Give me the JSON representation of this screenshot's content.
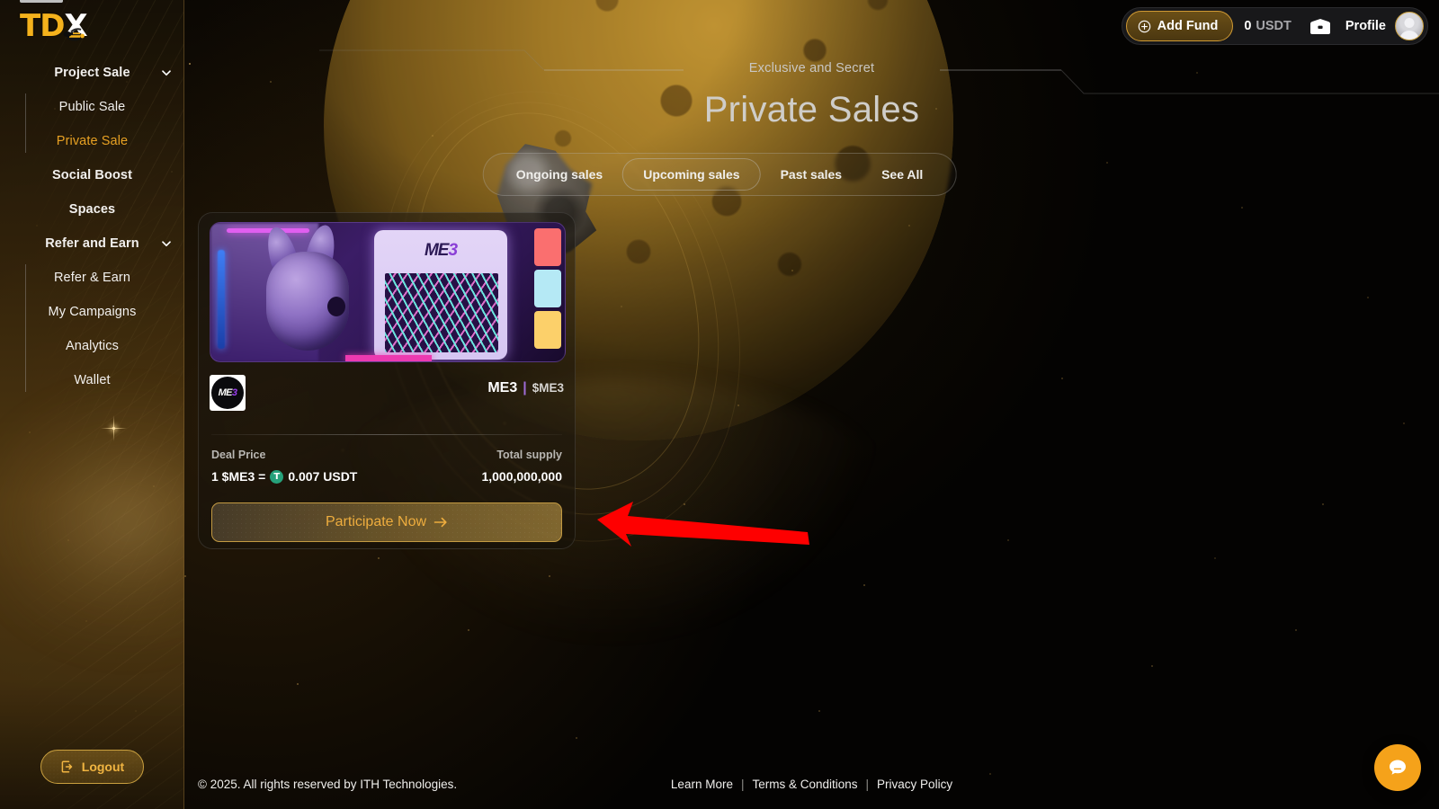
{
  "brand": {
    "name_gold": "TD",
    "name_white": "X",
    "icon": "bee-icon"
  },
  "sidebar": {
    "items": [
      {
        "label": "Project Sale",
        "type": "group",
        "expanded": true,
        "icon": "chevron-down-icon",
        "name": "project-sale"
      },
      {
        "label": "Public Sale",
        "type": "sub",
        "name": "public-sale"
      },
      {
        "label": "Private Sale",
        "type": "sub",
        "active": true,
        "name": "private-sale"
      },
      {
        "label": "Social Boost",
        "type": "item",
        "name": "social-boost"
      },
      {
        "label": "Spaces",
        "type": "item",
        "name": "spaces"
      },
      {
        "label": "Refer and Earn",
        "type": "group",
        "expanded": true,
        "icon": "chevron-down-icon",
        "name": "refer-and-earn"
      },
      {
        "label": "Refer & Earn",
        "type": "sub",
        "name": "refer-earn"
      },
      {
        "label": "My Campaigns",
        "type": "sub",
        "name": "my-campaigns"
      },
      {
        "label": "Analytics",
        "type": "sub",
        "name": "analytics"
      },
      {
        "label": "Wallet",
        "type": "sub",
        "name": "wallet"
      }
    ],
    "logout": {
      "label": "Logout",
      "icon": "logout-icon"
    }
  },
  "header": {
    "add_fund_label": "Add Fund",
    "add_fund_icon": "plus-circle-icon",
    "balance_amount": "0",
    "balance_currency": "USDT",
    "wallet_icon": "wallet-icon",
    "profile_label": "Profile",
    "avatar_icon": "user-avatar"
  },
  "hero": {
    "eyebrow": "Exclusive and Secret",
    "title": "Private Sales"
  },
  "tabs": {
    "items": [
      {
        "label": "Ongoing sales",
        "active": false,
        "name": "tab-ongoing-sales"
      },
      {
        "label": "Upcoming sales",
        "active": true,
        "name": "tab-upcoming-sales"
      },
      {
        "label": "Past sales",
        "active": false,
        "name": "tab-past-sales"
      },
      {
        "label": "See All",
        "active": false,
        "name": "tab-see-all"
      }
    ]
  },
  "sale_card": {
    "banner_logo_me": "ME",
    "banner_logo_3": "3",
    "coin_logo_me": "ME",
    "coin_logo_3": "3",
    "project_name": "ME3",
    "separator": "|",
    "symbol": "$ME3",
    "deal_price_label": "Deal Price",
    "deal_price_prefix": "1 $ME3 =",
    "deal_price_token_badge": "T",
    "deal_price_value": "0.007 USDT",
    "total_supply_label": "Total supply",
    "total_supply_value": "1,000,000,000",
    "cta_label": "Participate Now",
    "cta_icon": "arrow-right-icon"
  },
  "annotation": {
    "type": "red-arrow",
    "points_to": "Participate Now",
    "color": "#fe0000"
  },
  "footer": {
    "copyright": "© 2025. All rights reserved by ITH Technologies.",
    "links": [
      {
        "label": "Learn More",
        "name": "footer-link-learn-more"
      },
      {
        "label": "Terms & Conditions",
        "name": "footer-link-terms"
      },
      {
        "label": "Privacy Policy",
        "name": "footer-link-privacy"
      }
    ],
    "separator": "|"
  },
  "chat": {
    "icon": "chat-bubble-icon",
    "color": "#f5a21a"
  },
  "colors": {
    "accent_gold": "#e8a123",
    "brand_gold": "#f5b21c",
    "usdt_green": "#26a17b",
    "annotation_red": "#fe0000",
    "chat_orange": "#f5a21a"
  }
}
